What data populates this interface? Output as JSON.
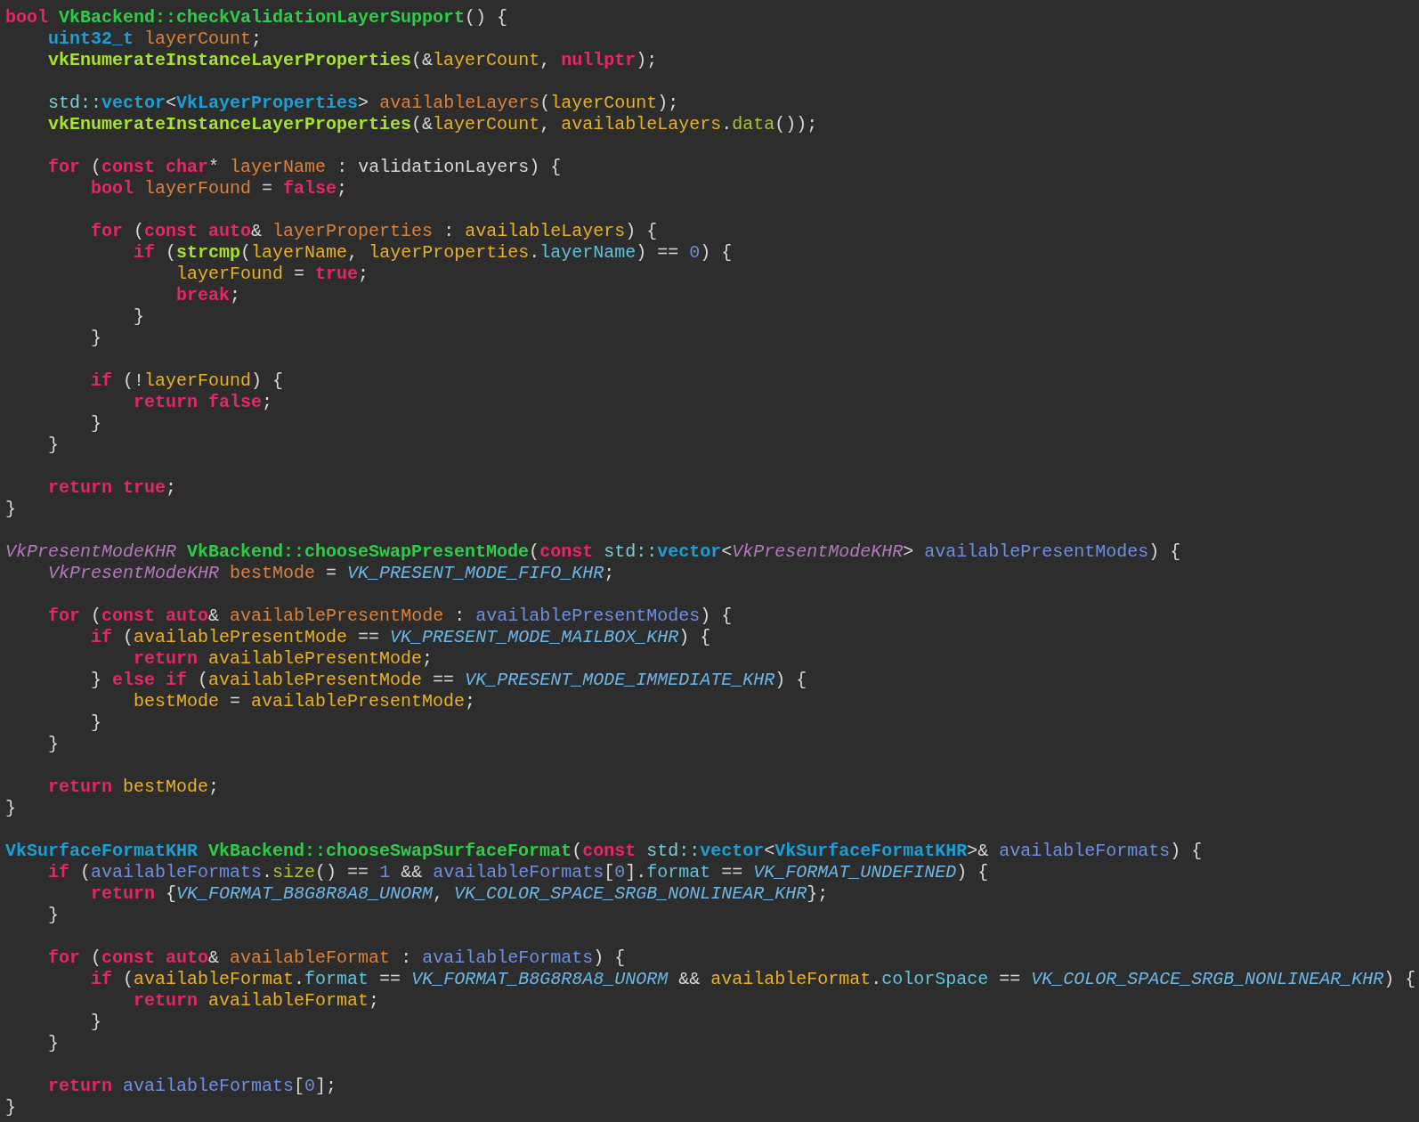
{
  "editor": {
    "lines": [
      {
        "kind": "code",
        "tokens": [
          {
            "kind": "kw",
            "text": "bool"
          },
          {
            "kind": "fn",
            "text": " VkBackend::checkValidationLayerSupport"
          },
          {
            "kind": "p",
            "text": "() {"
          }
        ]
      },
      {
        "kind": "code",
        "tokens": [
          {
            "kind": "type",
            "text": "    uint32_t"
          },
          {
            "kind": "decl",
            "text": " layerCount"
          },
          {
            "kind": "p",
            "text": ";"
          }
        ]
      },
      {
        "kind": "code",
        "tokens": [
          {
            "kind": "call",
            "text": "    vkEnumerateInstanceLayerProperties"
          },
          {
            "kind": "p",
            "text": "(&"
          },
          {
            "kind": "var",
            "text": "layerCount"
          },
          {
            "kind": "p",
            "text": ", "
          },
          {
            "kind": "kw",
            "text": "nullptr"
          },
          {
            "kind": "p",
            "text": ");"
          }
        ]
      },
      {
        "kind": "blank"
      },
      {
        "kind": "code",
        "tokens": [
          {
            "kind": "ns",
            "text": "    std::"
          },
          {
            "kind": "type",
            "text": "vector"
          },
          {
            "kind": "p",
            "text": "<"
          },
          {
            "kind": "type",
            "text": "VkLayerProperties"
          },
          {
            "kind": "p",
            "text": "> "
          },
          {
            "kind": "decl",
            "text": "availableLayers"
          },
          {
            "kind": "p",
            "text": "("
          },
          {
            "kind": "var",
            "text": "layerCount"
          },
          {
            "kind": "p",
            "text": ");"
          }
        ]
      },
      {
        "kind": "code",
        "tokens": [
          {
            "kind": "call",
            "text": "    vkEnumerateInstanceLayerProperties"
          },
          {
            "kind": "p",
            "text": "(&"
          },
          {
            "kind": "var",
            "text": "layerCount"
          },
          {
            "kind": "p",
            "text": ", "
          },
          {
            "kind": "var",
            "text": "availableLayers"
          },
          {
            "kind": "p",
            "text": "."
          },
          {
            "kind": "method",
            "text": "data"
          },
          {
            "kind": "p",
            "text": "());"
          }
        ]
      },
      {
        "kind": "blank"
      },
      {
        "kind": "code",
        "tokens": [
          {
            "kind": "kw",
            "text": "    for"
          },
          {
            "kind": "p",
            "text": " ("
          },
          {
            "kind": "kw",
            "text": "const"
          },
          {
            "kind": "kw",
            "text": " char"
          },
          {
            "kind": "p",
            "text": "* "
          },
          {
            "kind": "decl",
            "text": "layerName"
          },
          {
            "kind": "p",
            "text": " : validationLayers) {"
          }
        ]
      },
      {
        "kind": "code",
        "tokens": [
          {
            "kind": "kw",
            "text": "        bool"
          },
          {
            "kind": "decl",
            "text": " layerFound"
          },
          {
            "kind": "p",
            "text": " = "
          },
          {
            "kind": "kw",
            "text": "false"
          },
          {
            "kind": "p",
            "text": ";"
          }
        ]
      },
      {
        "kind": "blank"
      },
      {
        "kind": "code",
        "tokens": [
          {
            "kind": "kw",
            "text": "        for"
          },
          {
            "kind": "p",
            "text": " ("
          },
          {
            "kind": "kw",
            "text": "const"
          },
          {
            "kind": "kw",
            "text": " auto"
          },
          {
            "kind": "p",
            "text": "& "
          },
          {
            "kind": "decl",
            "text": "layerProperties"
          },
          {
            "kind": "p",
            "text": " : "
          },
          {
            "kind": "var",
            "text": "availableLayers"
          },
          {
            "kind": "p",
            "text": ") {"
          }
        ]
      },
      {
        "kind": "code",
        "tokens": [
          {
            "kind": "kw",
            "text": "            if"
          },
          {
            "kind": "p",
            "text": " ("
          },
          {
            "kind": "call",
            "text": "strcmp"
          },
          {
            "kind": "p",
            "text": "("
          },
          {
            "kind": "var",
            "text": "layerName"
          },
          {
            "kind": "p",
            "text": ", "
          },
          {
            "kind": "var",
            "text": "layerProperties"
          },
          {
            "kind": "p",
            "text": "."
          },
          {
            "kind": "member",
            "text": "layerName"
          },
          {
            "kind": "p",
            "text": ") == "
          },
          {
            "kind": "num",
            "text": "0"
          },
          {
            "kind": "p",
            "text": ") {"
          }
        ]
      },
      {
        "kind": "code",
        "tokens": [
          {
            "kind": "var",
            "text": "                layerFound"
          },
          {
            "kind": "p",
            "text": " = "
          },
          {
            "kind": "kw",
            "text": "true"
          },
          {
            "kind": "p",
            "text": ";"
          }
        ]
      },
      {
        "kind": "code",
        "tokens": [
          {
            "kind": "kw",
            "text": "                break"
          },
          {
            "kind": "p",
            "text": ";"
          }
        ]
      },
      {
        "kind": "code",
        "tokens": [
          {
            "kind": "p",
            "text": "            }"
          }
        ]
      },
      {
        "kind": "code",
        "tokens": [
          {
            "kind": "p",
            "text": "        }"
          }
        ]
      },
      {
        "kind": "blank"
      },
      {
        "kind": "code",
        "tokens": [
          {
            "kind": "kw",
            "text": "        if"
          },
          {
            "kind": "p",
            "text": " (!"
          },
          {
            "kind": "var",
            "text": "layerFound"
          },
          {
            "kind": "p",
            "text": ") {"
          }
        ]
      },
      {
        "kind": "code",
        "tokens": [
          {
            "kind": "kw",
            "text": "            return"
          },
          {
            "kind": "kw",
            "text": " false"
          },
          {
            "kind": "p",
            "text": ";"
          }
        ]
      },
      {
        "kind": "code",
        "tokens": [
          {
            "kind": "p",
            "text": "        }"
          }
        ]
      },
      {
        "kind": "code",
        "tokens": [
          {
            "kind": "p",
            "text": "    }"
          }
        ]
      },
      {
        "kind": "blank"
      },
      {
        "kind": "code",
        "tokens": [
          {
            "kind": "kw",
            "text": "    return"
          },
          {
            "kind": "kw",
            "text": " true"
          },
          {
            "kind": "p",
            "text": ";"
          }
        ]
      },
      {
        "kind": "code",
        "tokens": [
          {
            "kind": "p",
            "text": "}"
          }
        ]
      },
      {
        "kind": "blank"
      },
      {
        "kind": "code",
        "tokens": [
          {
            "kind": "typedef",
            "text": "VkPresentModeKHR"
          },
          {
            "kind": "fn",
            "text": " VkBackend::chooseSwapPresentMode"
          },
          {
            "kind": "p",
            "text": "("
          },
          {
            "kind": "kw",
            "text": "const"
          },
          {
            "kind": "ns",
            "text": " std::"
          },
          {
            "kind": "type",
            "text": "vector"
          },
          {
            "kind": "p",
            "text": "<"
          },
          {
            "kind": "typedef",
            "text": "VkPresentModeKHR"
          },
          {
            "kind": "p",
            "text": "> "
          },
          {
            "kind": "param",
            "text": "availablePresentModes"
          },
          {
            "kind": "p",
            "text": ") {"
          }
        ]
      },
      {
        "kind": "code",
        "tokens": [
          {
            "kind": "typedef",
            "text": "    VkPresentModeKHR"
          },
          {
            "kind": "decl",
            "text": " bestMode"
          },
          {
            "kind": "p",
            "text": " = "
          },
          {
            "kind": "enum",
            "text": "VK_PRESENT_MODE_FIFO_KHR"
          },
          {
            "kind": "p",
            "text": ";"
          }
        ]
      },
      {
        "kind": "blank"
      },
      {
        "kind": "code",
        "tokens": [
          {
            "kind": "kw",
            "text": "    for"
          },
          {
            "kind": "p",
            "text": " ("
          },
          {
            "kind": "kw",
            "text": "const"
          },
          {
            "kind": "kw",
            "text": " auto"
          },
          {
            "kind": "p",
            "text": "& "
          },
          {
            "kind": "decl",
            "text": "availablePresentMode"
          },
          {
            "kind": "p",
            "text": " : "
          },
          {
            "kind": "param",
            "text": "availablePresentModes"
          },
          {
            "kind": "p",
            "text": ") {"
          }
        ]
      },
      {
        "kind": "code",
        "tokens": [
          {
            "kind": "kw",
            "text": "        if"
          },
          {
            "kind": "p",
            "text": " ("
          },
          {
            "kind": "var",
            "text": "availablePresentMode"
          },
          {
            "kind": "p",
            "text": " == "
          },
          {
            "kind": "enum",
            "text": "VK_PRESENT_MODE_MAILBOX_KHR"
          },
          {
            "kind": "p",
            "text": ") {"
          }
        ]
      },
      {
        "kind": "code",
        "tokens": [
          {
            "kind": "kw",
            "text": "            return"
          },
          {
            "kind": "var",
            "text": " availablePresentMode"
          },
          {
            "kind": "p",
            "text": ";"
          }
        ]
      },
      {
        "kind": "code",
        "tokens": [
          {
            "kind": "p",
            "text": "        } "
          },
          {
            "kind": "kw",
            "text": "else if"
          },
          {
            "kind": "p",
            "text": " ("
          },
          {
            "kind": "var",
            "text": "availablePresentMode"
          },
          {
            "kind": "p",
            "text": " == "
          },
          {
            "kind": "enum",
            "text": "VK_PRESENT_MODE_IMMEDIATE_KHR"
          },
          {
            "kind": "p",
            "text": ") {"
          }
        ]
      },
      {
        "kind": "code",
        "tokens": [
          {
            "kind": "var",
            "text": "            bestMode"
          },
          {
            "kind": "p",
            "text": " = "
          },
          {
            "kind": "var",
            "text": "availablePresentMode"
          },
          {
            "kind": "p",
            "text": ";"
          }
        ]
      },
      {
        "kind": "code",
        "tokens": [
          {
            "kind": "p",
            "text": "        }"
          }
        ]
      },
      {
        "kind": "code",
        "tokens": [
          {
            "kind": "p",
            "text": "    }"
          }
        ]
      },
      {
        "kind": "blank"
      },
      {
        "kind": "code",
        "tokens": [
          {
            "kind": "kw",
            "text": "    return"
          },
          {
            "kind": "var",
            "text": " bestMode"
          },
          {
            "kind": "p",
            "text": ";"
          }
        ]
      },
      {
        "kind": "code",
        "tokens": [
          {
            "kind": "p",
            "text": "}"
          }
        ]
      },
      {
        "kind": "blank"
      },
      {
        "kind": "code",
        "tokens": [
          {
            "kind": "type",
            "text": "VkSurfaceFormatKHR"
          },
          {
            "kind": "fn",
            "text": " VkBackend::chooseSwapSurfaceFormat"
          },
          {
            "kind": "p",
            "text": "("
          },
          {
            "kind": "kw",
            "text": "const"
          },
          {
            "kind": "ns",
            "text": " std::"
          },
          {
            "kind": "type",
            "text": "vector"
          },
          {
            "kind": "p",
            "text": "<"
          },
          {
            "kind": "type",
            "text": "VkSurfaceFormatKHR"
          },
          {
            "kind": "p",
            "text": ">& "
          },
          {
            "kind": "param",
            "text": "availableFormats"
          },
          {
            "kind": "p",
            "text": ") {"
          }
        ]
      },
      {
        "kind": "code",
        "tokens": [
          {
            "kind": "kw",
            "text": "    if"
          },
          {
            "kind": "p",
            "text": " ("
          },
          {
            "kind": "param",
            "text": "availableFormats"
          },
          {
            "kind": "p",
            "text": "."
          },
          {
            "kind": "method",
            "text": "size"
          },
          {
            "kind": "p",
            "text": "() == "
          },
          {
            "kind": "num",
            "text": "1"
          },
          {
            "kind": "p",
            "text": " && "
          },
          {
            "kind": "param",
            "text": "availableFormats"
          },
          {
            "kind": "p",
            "text": "["
          },
          {
            "kind": "num",
            "text": "0"
          },
          {
            "kind": "p",
            "text": "]."
          },
          {
            "kind": "member",
            "text": "format"
          },
          {
            "kind": "p",
            "text": " == "
          },
          {
            "kind": "enum",
            "text": "VK_FORMAT_UNDEFINED"
          },
          {
            "kind": "p",
            "text": ") {"
          }
        ]
      },
      {
        "kind": "code",
        "tokens": [
          {
            "kind": "kw",
            "text": "        return"
          },
          {
            "kind": "p",
            "text": " {"
          },
          {
            "kind": "enum",
            "text": "VK_FORMAT_B8G8R8A8_UNORM"
          },
          {
            "kind": "p",
            "text": ", "
          },
          {
            "kind": "enum",
            "text": "VK_COLOR_SPACE_SRGB_NONLINEAR_KHR"
          },
          {
            "kind": "p",
            "text": "};"
          }
        ]
      },
      {
        "kind": "code",
        "tokens": [
          {
            "kind": "p",
            "text": "    }"
          }
        ]
      },
      {
        "kind": "blank"
      },
      {
        "kind": "code",
        "tokens": [
          {
            "kind": "kw",
            "text": "    for"
          },
          {
            "kind": "p",
            "text": " ("
          },
          {
            "kind": "kw",
            "text": "const"
          },
          {
            "kind": "kw",
            "text": " auto"
          },
          {
            "kind": "p",
            "text": "& "
          },
          {
            "kind": "decl",
            "text": "availableFormat"
          },
          {
            "kind": "p",
            "text": " : "
          },
          {
            "kind": "param",
            "text": "availableFormats"
          },
          {
            "kind": "p",
            "text": ") {"
          }
        ]
      },
      {
        "kind": "code",
        "tokens": [
          {
            "kind": "kw",
            "text": "        if"
          },
          {
            "kind": "p",
            "text": " ("
          },
          {
            "kind": "var",
            "text": "availableFormat"
          },
          {
            "kind": "p",
            "text": "."
          },
          {
            "kind": "member",
            "text": "format"
          },
          {
            "kind": "p",
            "text": " == "
          },
          {
            "kind": "enum",
            "text": "VK_FORMAT_B8G8R8A8_UNORM"
          },
          {
            "kind": "p",
            "text": " && "
          },
          {
            "kind": "var",
            "text": "availableFormat"
          },
          {
            "kind": "p",
            "text": "."
          },
          {
            "kind": "member",
            "text": "colorSpace"
          },
          {
            "kind": "p",
            "text": " == "
          },
          {
            "kind": "enum",
            "text": "VK_COLOR_SPACE_SRGB_NONLINEAR_KHR"
          },
          {
            "kind": "p",
            "text": ") {"
          }
        ]
      },
      {
        "kind": "code",
        "tokens": [
          {
            "kind": "kw",
            "text": "            return"
          },
          {
            "kind": "var",
            "text": " availableFormat"
          },
          {
            "kind": "p",
            "text": ";"
          }
        ]
      },
      {
        "kind": "code",
        "tokens": [
          {
            "kind": "p",
            "text": "        }"
          }
        ]
      },
      {
        "kind": "code",
        "tokens": [
          {
            "kind": "p",
            "text": "    }"
          }
        ]
      },
      {
        "kind": "blank"
      },
      {
        "kind": "code",
        "tokens": [
          {
            "kind": "kw",
            "text": "    return"
          },
          {
            "kind": "param",
            "text": " availableFormats"
          },
          {
            "kind": "p",
            "text": "["
          },
          {
            "kind": "num",
            "text": "0"
          },
          {
            "kind": "p",
            "text": "];"
          }
        ]
      },
      {
        "kind": "code",
        "tokens": [
          {
            "kind": "p",
            "text": "}"
          }
        ]
      }
    ]
  }
}
